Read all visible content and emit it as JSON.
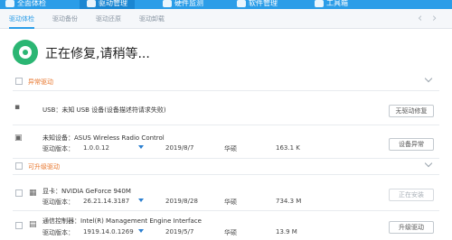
{
  "main_tabs": [
    {
      "label": "全面体检",
      "icon": "shield-icon"
    },
    {
      "label": "驱动管理",
      "icon": "gear-icon"
    },
    {
      "label": "硬件监测",
      "icon": "monitor-icon"
    },
    {
      "label": "软件管理",
      "icon": "apps-icon"
    },
    {
      "label": "工具箱",
      "icon": "toolbox-icon"
    }
  ],
  "sub_tabs": [
    "驱动体检",
    "驱动备份",
    "驱动还原",
    "驱动卸载"
  ],
  "status_text": "正在修复,请稍等...",
  "sections": {
    "abnormal": "异常驱动",
    "upgradable": "可升级驱动"
  },
  "devices": [
    {
      "name": "USB：未知 USB 设备(设备描述符请求失败)",
      "icon": "usb-icon",
      "button": "无驱动修复"
    },
    {
      "name": "未知设备：ASUS Wireless Radio Control",
      "icon": "monitor-icon",
      "version_label": "驱动版本：",
      "version": "1.0.0.12",
      "date": "2019/8/7",
      "vendor": "华硕",
      "size": "163.1 K",
      "button": "设备异常"
    },
    {
      "name": "显卡：NVIDIA GeForce 940M",
      "icon": "display-card-icon",
      "version_label": "驱动版本：",
      "version": "26.21.14.3187",
      "date": "2019/8/28",
      "vendor": "华硕",
      "size": "734.3 M",
      "button": "正在安装"
    },
    {
      "name": "通信控制器：Intel(R) Management Engine Interface",
      "icon": "controller-icon",
      "version_label": "驱动版本：",
      "version": "1919.14.0.1269",
      "date": "2019/5/7",
      "vendor": "华硕",
      "size": "13.9 M",
      "button": "升级驱动"
    }
  ],
  "colors": {
    "accent": "#2b9de8",
    "status_green": "#2bb673",
    "section_orange": "#e8762d"
  }
}
